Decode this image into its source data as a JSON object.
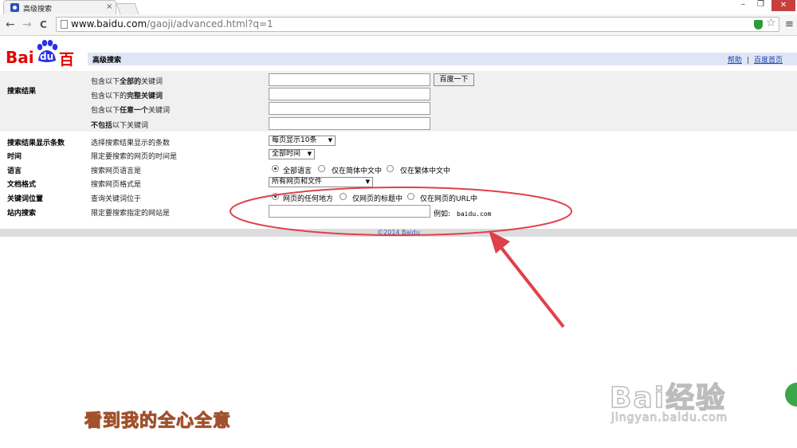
{
  "browser": {
    "tab_title": "高级搜索",
    "tab_close": "×",
    "url_host": "www.baidu.com",
    "url_path": "/gaoji/advanced.html?q=1",
    "win_minimize": "–",
    "win_restore": "❐",
    "win_close": "✕",
    "back": "←",
    "forward": "→",
    "reload": "C",
    "star": "☆",
    "menu": "≡"
  },
  "logo": {
    "bai": "Bai",
    "du": "du",
    "cn": "百度"
  },
  "header": {
    "title": "高级搜索",
    "help": "帮助",
    "sep": "|",
    "home": "百度首页"
  },
  "search_results": {
    "label": "搜索结果",
    "all_words_pre": "包含以下",
    "all_words_bold": "全部的",
    "all_words_post": "关键词",
    "exact_pre": "包含以下的",
    "exact_bold": "完整关键词",
    "any_pre": "包含以下",
    "any_bold": "任意一个",
    "any_post": "关键词",
    "exclude_bold": "不包括",
    "exclude_post": "以下关键词",
    "search_button": "百度一下"
  },
  "rows": {
    "count_label": "搜索结果显示条数",
    "count_desc": "选择搜索结果显示的条数",
    "count_value": "每页显示10条",
    "time_label": "时间",
    "time_desc": "限定要搜索的网页的时间是",
    "time_value": "全部时间",
    "lang_label": "语言",
    "lang_desc": "搜索网页语言是",
    "lang_opt1": "全部语言",
    "lang_opt2": "仅在简体中文中",
    "lang_opt3": "仅在繁体中文中",
    "format_label": "文档格式",
    "format_desc": "搜索网页格式是",
    "format_value": "所有网页和文件",
    "pos_label": "关键词位置",
    "pos_desc": "查询关键词位于",
    "pos_opt1": "网页的任何地方",
    "pos_opt2": "仅网页的标题中",
    "pos_opt3": "仅在网页的URL中",
    "site_label": "站内搜索",
    "site_desc": "限定要搜索指定的网站是",
    "example_label": "例如:",
    "example_value": "baidu.com"
  },
  "footer": {
    "copyright": "©2014 Baidu"
  },
  "overlay": {
    "caption": "看到我的全心全意",
    "watermark_brand": "Bai经验",
    "watermark_url": "jingyan.baidu.com",
    "annotation_color": "#e0404a"
  }
}
